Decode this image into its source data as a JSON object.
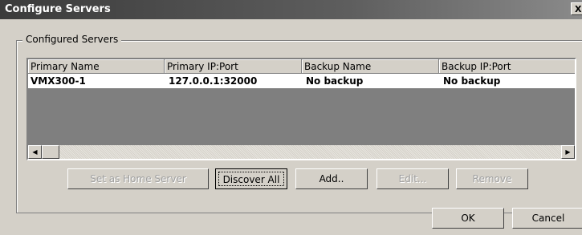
{
  "window": {
    "title": "Configure Servers",
    "close_glyph": "X"
  },
  "group": {
    "label": "Configured Servers"
  },
  "table": {
    "columns": [
      "Primary Name",
      "Primary IP:Port",
      "Backup Name",
      "Backup IP:Port"
    ],
    "rows": [
      [
        "VMX300-1",
        "127.0.0.1:32000",
        "No backup",
        "No backup"
      ]
    ]
  },
  "scrollbar": {
    "left_glyph": "◀",
    "right_glyph": "▶"
  },
  "buttons": {
    "set_home": "Set as Home Server",
    "discover_all": "Discover All",
    "add": "Add..",
    "edit": "Edit...",
    "remove": "Remove",
    "ok": "OK",
    "cancel": "Cancel"
  }
}
